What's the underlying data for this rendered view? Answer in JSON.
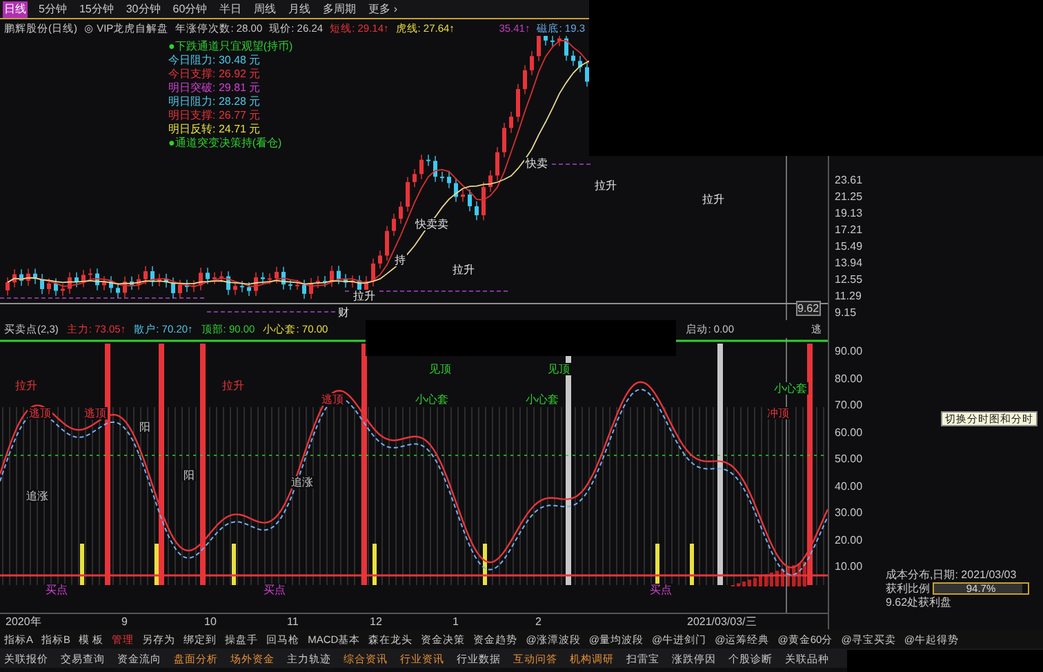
{
  "period_tabs": [
    {
      "label": "日线",
      "selected": true
    },
    {
      "label": "5分钟",
      "selected": false
    },
    {
      "label": "15分钟",
      "selected": false
    },
    {
      "label": "30分钟",
      "selected": false
    },
    {
      "label": "60分钟",
      "selected": false
    },
    {
      "label": "半日",
      "selected": false
    },
    {
      "label": "周线",
      "selected": false
    },
    {
      "label": "月线",
      "selected": false
    },
    {
      "label": "多周期",
      "selected": false
    },
    {
      "label": "更多 ›",
      "selected": false
    }
  ],
  "info_line": [
    {
      "text": "鹏辉股份(日线)",
      "color": "#c8c8c8"
    },
    {
      "text": "◎ VIP龙虎自解盘",
      "color": "#c8c8c8"
    },
    {
      "text": "年涨停次数: 28.00",
      "color": "#c8c8c8"
    },
    {
      "text": "现价: 26.24",
      "color": "#c8c8c8"
    },
    {
      "text": "短线: 29.14↑",
      "color": "#e8343a"
    },
    {
      "text": "虎线: 27.64↑",
      "color": "#e8e040"
    },
    {
      "text": "35.41↑",
      "color": "#c040c0"
    },
    {
      "text": "磁底: 19.3",
      "color": "#6aa8e8"
    }
  ],
  "levels_legend": [
    {
      "text": "●下跌通道只宜观望(持币)",
      "color": "#30d030"
    },
    {
      "text": "今日阻力: 30.48 元",
      "color": "#50c8e8"
    },
    {
      "text": "今日支撑: 26.92 元",
      "color": "#e8343a"
    },
    {
      "text": "明日突破: 29.81 元",
      "color": "#d040d0"
    },
    {
      "text": "明日阻力: 28.28 元",
      "color": "#50c8e8"
    },
    {
      "text": "明日支撑: 26.77 元",
      "color": "#e8343a"
    },
    {
      "text": "明日反转: 24.71 元",
      "color": "#e8e040"
    },
    {
      "text": "●通道突变决策持(看仓)",
      "color": "#30d030"
    }
  ],
  "price_chart": {
    "axis_labels": [
      "23.61",
      "21.25",
      "19.13",
      "17.21",
      "15.49",
      "13.94",
      "12.55",
      "11.29",
      "9.15"
    ],
    "current_price": "9.62",
    "signals": [
      {
        "text": "快卖"
      },
      {
        "text": "快卖卖"
      },
      {
        "text": "拉升"
      },
      {
        "text": "拉升"
      },
      {
        "text": "拉升"
      },
      {
        "text": "持"
      },
      {
        "text": "拉升"
      },
      {
        "text": "财"
      }
    ]
  },
  "indicator": {
    "title": "买卖点(2,3)",
    "readings": [
      {
        "text": "主力: 73.05↑",
        "color": "#e8343a"
      },
      {
        "text": "散户: 70.20↑",
        "color": "#50c8e8"
      },
      {
        "text": "顶部: 90.00",
        "color": "#30d030"
      },
      {
        "text": "小心套: 70.00",
        "color": "#e8e040"
      }
    ],
    "readings_right": [
      {
        "text": "启动: 0.00",
        "color": "#c8c8c8"
      },
      {
        "text": "逃",
        "color": "#c8c8c8"
      }
    ],
    "axis_labels": [
      "90.00",
      "80.00",
      "70.00",
      "60.00",
      "50.00",
      "40.00",
      "30.00",
      "20.00",
      "10.00"
    ],
    "signals": [
      {
        "text": "拉升",
        "color": "#e8343a"
      },
      {
        "text": "逃顶",
        "color": "#e8343a"
      },
      {
        "text": "阳",
        "color": "#c8c8c8"
      },
      {
        "text": "逃顶",
        "color": "#e8343a"
      },
      {
        "text": "阳",
        "color": "#c8c8c8"
      },
      {
        "text": "拉升",
        "color": "#e8343a"
      },
      {
        "text": "逃顶",
        "color": "#e8343a"
      },
      {
        "text": "小心套",
        "color": "#30d030"
      },
      {
        "text": "见顶",
        "color": "#30d030"
      },
      {
        "text": "小心套",
        "color": "#30d030"
      },
      {
        "text": "见顶",
        "color": "#30d030"
      },
      {
        "text": "冲顶",
        "color": "#e8343a"
      },
      {
        "text": "小心套",
        "color": "#30d030"
      },
      {
        "text": "追涨",
        "color": "#c8c8c8"
      },
      {
        "text": "追涨",
        "color": "#c8c8c8"
      },
      {
        "text": "买点",
        "color": "#d040d0"
      },
      {
        "text": "买点",
        "color": "#d040d0"
      },
      {
        "text": "买点",
        "color": "#d040d0"
      }
    ]
  },
  "x_axis": [
    "2020年",
    "9",
    "10",
    "11",
    "12",
    "1",
    "2",
    "2021/03/03/三"
  ],
  "cost_panel": {
    "title": "成本分布,日期: 2021/03/03",
    "label": "获利比例",
    "reading": "94.7%",
    "level": 0.947,
    "note": "9.62处获利盘"
  },
  "tooltip": "切换分时图和分时",
  "toolbar": [
    {
      "label": "指标A",
      "highlight": false
    },
    {
      "label": "指标B",
      "highlight": false
    },
    {
      "label": "模 板",
      "highlight": false
    },
    {
      "label": "管理",
      "highlight": true
    },
    {
      "label": "另存为",
      "highlight": false
    },
    {
      "label": "绑定到",
      "highlight": false
    },
    {
      "label": "操盘手",
      "highlight": false
    },
    {
      "label": "回马枪",
      "highlight": false
    },
    {
      "label": "MACD基本",
      "highlight": false
    },
    {
      "label": "森在龙头",
      "highlight": false
    },
    {
      "label": "资金决策",
      "highlight": false
    },
    {
      "label": "资金趋势",
      "highlight": false
    },
    {
      "label": "@涨潭波段",
      "highlight": false
    },
    {
      "label": "@量均波段",
      "highlight": false
    },
    {
      "label": "@牛进剑门",
      "highlight": false
    },
    {
      "label": "@运筹经典",
      "highlight": false
    },
    {
      "label": "@黄金60分",
      "highlight": false
    },
    {
      "label": "@寻宝买卖",
      "highlight": false
    },
    {
      "label": "@牛起得势",
      "highlight": false
    }
  ],
  "bottom_tabs": [
    {
      "label": "关联报价",
      "highlight": false
    },
    {
      "label": "交易查询",
      "highlight": false
    },
    {
      "label": "资金流向",
      "highlight": false
    },
    {
      "label": "盘面分析",
      "highlight": true
    },
    {
      "label": "场外资金",
      "highlight": true
    },
    {
      "label": "主力轨迹",
      "highlight": false
    },
    {
      "label": "综合资讯",
      "highlight": true
    },
    {
      "label": "行业资讯",
      "highlight": true
    },
    {
      "label": "行业数据",
      "highlight": false
    },
    {
      "label": "互动问答",
      "highlight": true
    },
    {
      "label": "机构调研",
      "highlight": true
    },
    {
      "label": "扫雷宝",
      "highlight": false
    },
    {
      "label": "涨跌停因",
      "highlight": false
    },
    {
      "label": "个股诊断",
      "highlight": false
    },
    {
      "label": "关联品种",
      "highlight": false
    }
  ]
}
